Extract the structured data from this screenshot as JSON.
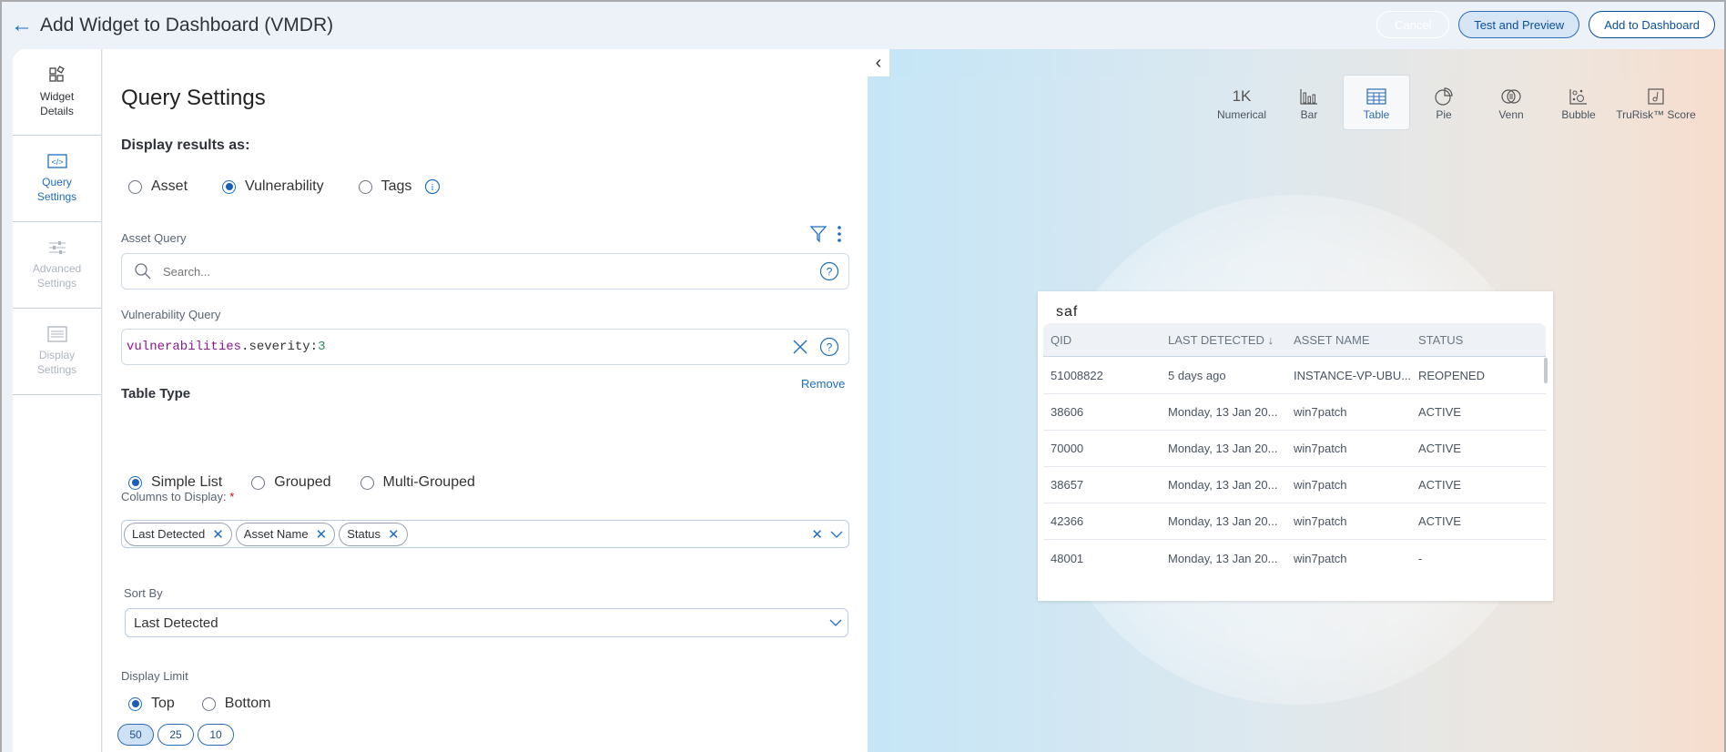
{
  "header": {
    "back_icon": "arrow-left-icon",
    "title": "Add Widget to Dashboard (VMDR)",
    "buttons": {
      "cancel": "Cancel",
      "test": "Test and Preview",
      "add": "Add to Dashboard"
    }
  },
  "sidebar": {
    "items": [
      {
        "label_1": "Widget",
        "label_2": "Details",
        "icon": "widget-shapes-icon",
        "state": "normal"
      },
      {
        "label_1": "Query",
        "label_2": "Settings",
        "icon": "code-icon",
        "state": "active"
      },
      {
        "label_1": "Advanced",
        "label_2": "Settings",
        "icon": "sliders-icon",
        "state": "disabled"
      },
      {
        "label_1": "Display",
        "label_2": "Settings",
        "icon": "display-settings-icon",
        "state": "disabled"
      }
    ]
  },
  "form": {
    "title": "Query Settings",
    "display_results_label": "Display results as:",
    "display_results_options": [
      "Asset",
      "Vulnerability",
      "Tags"
    ],
    "display_results_selected": "Vulnerability",
    "asset_query": {
      "label": "Asset Query",
      "placeholder": "Search...",
      "value": ""
    },
    "vuln_query": {
      "label": "Vulnerability Query",
      "token_key": "vulnerabilities",
      "token_dot": ".",
      "token_field": "severity:",
      "token_value": "3"
    },
    "remove_link": "Remove",
    "table_type": {
      "label": "Table Type",
      "options": [
        "Simple List",
        "Grouped",
        "Multi-Grouped"
      ],
      "selected": "Simple List"
    },
    "columns": {
      "label": "Columns to Display:",
      "required_mark": "*",
      "chips": [
        "Last Detected",
        "Asset Name",
        "Status"
      ]
    },
    "sort_by": {
      "label": "Sort By",
      "value": "Last Detected"
    },
    "display_limit": {
      "label": "Display Limit",
      "options": [
        "Top",
        "Bottom"
      ],
      "selected": "Top",
      "counts": [
        "50",
        "25",
        "10"
      ],
      "selected_count": "50"
    }
  },
  "preview": {
    "widget_types": [
      {
        "label": "Numerical",
        "glyph": "1K",
        "icon": "numerical-icon"
      },
      {
        "label": "Bar",
        "icon": "bar-chart-icon"
      },
      {
        "label": "Table",
        "icon": "table-icon",
        "selected": true
      },
      {
        "label": "Pie",
        "icon": "pie-chart-icon"
      },
      {
        "label": "Venn",
        "icon": "venn-icon"
      },
      {
        "label": "Bubble",
        "icon": "bubble-chart-icon"
      },
      {
        "label": "TruRisk™ Score",
        "icon": "trurisk-score-icon"
      }
    ],
    "widget": {
      "title": "saf",
      "columns": [
        "QID",
        "LAST DETECTED",
        "ASSET NAME",
        "STATUS"
      ],
      "sort_indicator": "↓",
      "rows": [
        [
          "51008822",
          "5 days ago",
          "INSTANCE-VP-UBU...",
          "REOPENED"
        ],
        [
          "38606",
          "Monday, 13 Jan 20...",
          "win7patch",
          "ACTIVE"
        ],
        [
          "70000",
          "Monday, 13 Jan 20...",
          "win7patch",
          "ACTIVE"
        ],
        [
          "38657",
          "Monday, 13 Jan 20...",
          "win7patch",
          "ACTIVE"
        ],
        [
          "42366",
          "Monday, 13 Jan 20...",
          "win7patch",
          "ACTIVE"
        ],
        [
          "48001",
          "Monday, 13 Jan 20...",
          "win7patch",
          "-"
        ]
      ]
    }
  },
  "colors": {
    "accent": "#1f6ec0",
    "primary_dark": "#0b4f9c",
    "required": "#d0021b"
  }
}
